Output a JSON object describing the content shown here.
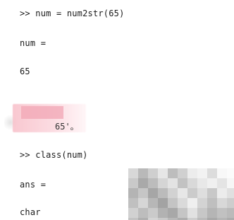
{
  "console": {
    "lines": [
      {
        "text": ">> num = num2str(65)",
        "kind": "command"
      },
      {
        "text": "num =",
        "kind": "output"
      },
      {
        "text": "65",
        "kind": "output"
      },
      {
        "text": "65'。",
        "kind": "partially-redacted"
      },
      {
        "text": ">> class(num)",
        "kind": "command"
      },
      {
        "text": "ans =",
        "kind": "output"
      },
      {
        "text": "char",
        "kind": "output"
      }
    ]
  },
  "colors": {
    "background": "#ffffff",
    "text": "#1a1a1a",
    "redaction_pink": "#f7c4cd",
    "pixelation_gray": "#c4c4c4"
  }
}
